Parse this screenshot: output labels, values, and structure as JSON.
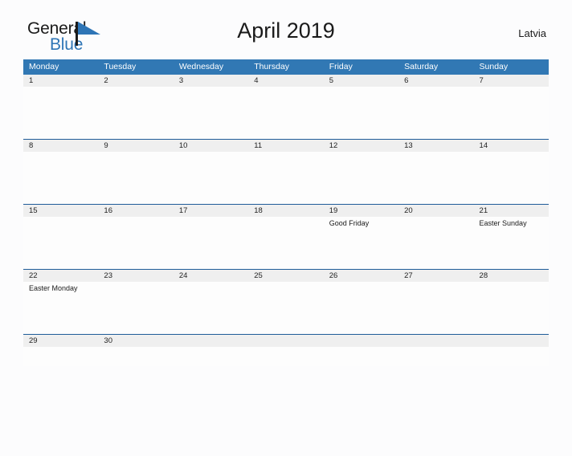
{
  "brand": {
    "name_part1": "General",
    "name_part2": "Blue",
    "flag_icon": "flag-triangle-icon",
    "color_primary": "#2e75b6",
    "color_text": "#1a1a1a"
  },
  "header": {
    "title": "April 2019",
    "region": "Latvia"
  },
  "theme": {
    "header_blue": "#3178b4",
    "divider_blue": "#1f5c99",
    "date_band_gray": "#efefef",
    "page_background": "#fcfcfd"
  },
  "calendar": {
    "weekday_headers": [
      "Monday",
      "Tuesday",
      "Wednesday",
      "Thursday",
      "Friday",
      "Saturday",
      "Sunday"
    ],
    "weeks": [
      {
        "dates": [
          "1",
          "2",
          "3",
          "4",
          "5",
          "6",
          "7"
        ],
        "notes": [
          "",
          "",
          "",
          "",
          "",
          "",
          ""
        ]
      },
      {
        "dates": [
          "8",
          "9",
          "10",
          "11",
          "12",
          "13",
          "14"
        ],
        "notes": [
          "",
          "",
          "",
          "",
          "",
          "",
          ""
        ]
      },
      {
        "dates": [
          "15",
          "16",
          "17",
          "18",
          "19",
          "20",
          "21"
        ],
        "notes": [
          "",
          "",
          "",
          "",
          "Good Friday",
          "",
          "Easter Sunday"
        ]
      },
      {
        "dates": [
          "22",
          "23",
          "24",
          "25",
          "26",
          "27",
          "28"
        ],
        "notes": [
          "Easter Monday",
          "",
          "",
          "",
          "",
          "",
          ""
        ]
      },
      {
        "dates": [
          "29",
          "30",
          "",
          "",
          "",
          "",
          ""
        ],
        "notes": [
          "",
          "",
          "",
          "",
          "",
          "",
          ""
        ]
      }
    ]
  }
}
